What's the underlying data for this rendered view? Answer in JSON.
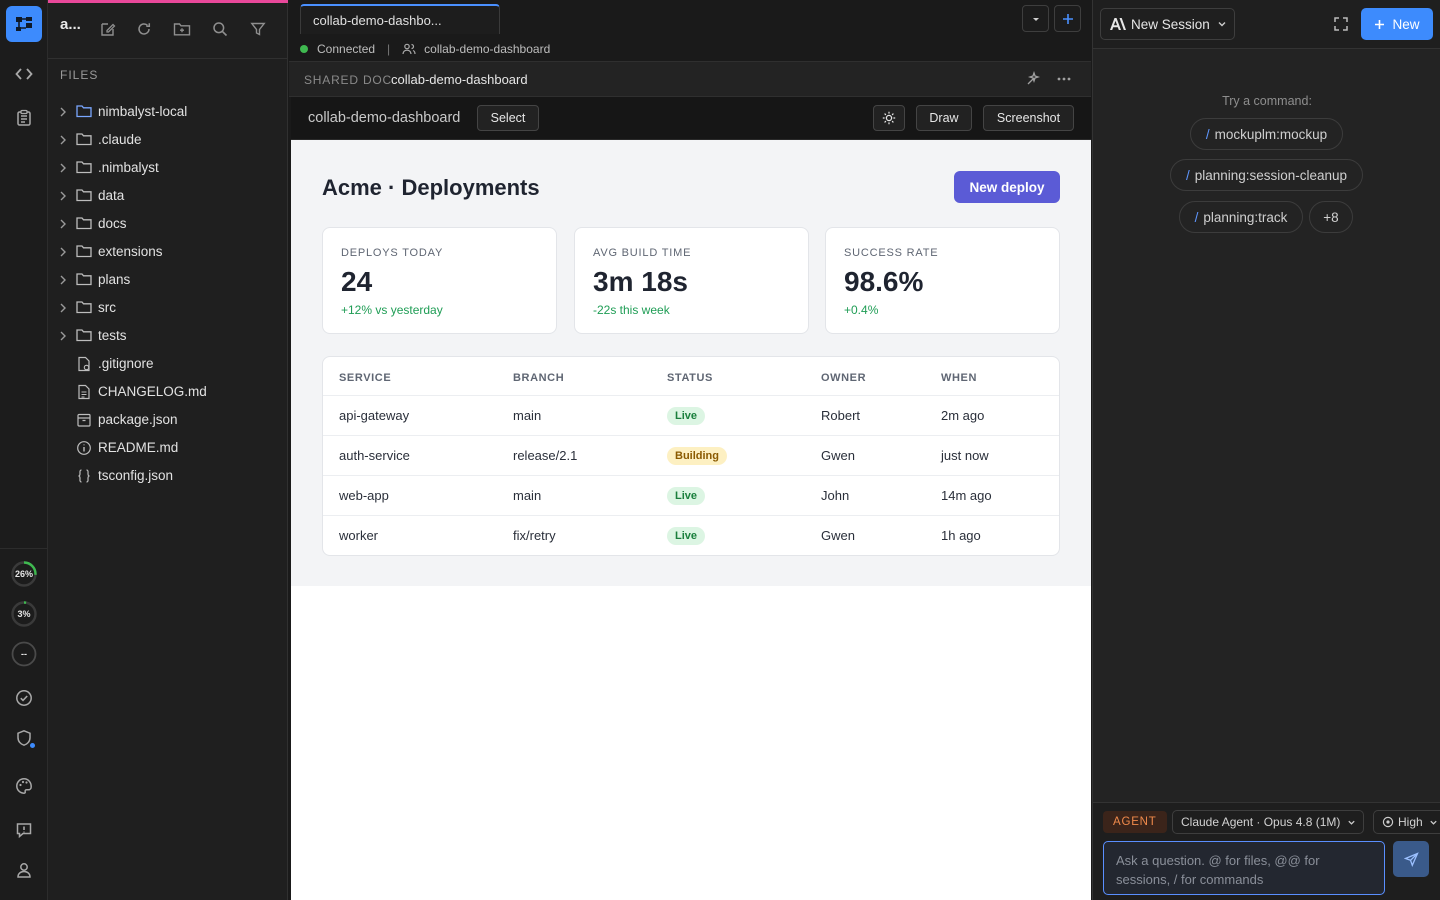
{
  "activity_bar": {
    "usage_rings": [
      {
        "label": "26%",
        "fraction": 0.26
      },
      {
        "label": "3%",
        "fraction": 0.03
      },
      {
        "label": "--",
        "fraction": 0
      }
    ]
  },
  "explorer": {
    "title": "a...",
    "section_label": "FILES",
    "items": [
      {
        "name": "nimbalyst-local",
        "type": "folder",
        "icon": "folder-icon"
      },
      {
        "name": ".claude",
        "type": "folder",
        "icon": "folder-icon"
      },
      {
        "name": ".nimbalyst",
        "type": "folder",
        "icon": "folder-icon"
      },
      {
        "name": "data",
        "type": "folder",
        "icon": "folder-icon"
      },
      {
        "name": "docs",
        "type": "folder",
        "icon": "folder-icon"
      },
      {
        "name": "extensions",
        "type": "folder",
        "icon": "folder-icon"
      },
      {
        "name": "plans",
        "type": "folder",
        "icon": "folder-icon"
      },
      {
        "name": "src",
        "type": "folder",
        "icon": "folder-icon"
      },
      {
        "name": "tests",
        "type": "folder",
        "icon": "folder-icon"
      },
      {
        "name": ".gitignore",
        "type": "file",
        "icon": "gear-file-icon"
      },
      {
        "name": "CHANGELOG.md",
        "type": "file",
        "icon": "document-icon"
      },
      {
        "name": "package.json",
        "type": "file",
        "icon": "package-icon"
      },
      {
        "name": "README.md",
        "type": "file",
        "icon": "info-icon"
      },
      {
        "name": "tsconfig.json",
        "type": "file",
        "icon": "braces-icon"
      }
    ]
  },
  "editor": {
    "tab_label": "collab-demo-dashbo...",
    "connection_status": "Connected",
    "connection_separator": "|",
    "shared_name": "collab-demo-dashboard",
    "doc_kind": "SHARED DOC",
    "doc_name": "collab-demo-dashboard",
    "mockup_title": "collab-demo-dashboard",
    "select_label": "Select",
    "draw_label": "Draw",
    "screenshot_label": "Screenshot"
  },
  "mockup": {
    "title": "Acme · Deployments",
    "new_deploy_label": "New deploy",
    "stats": [
      {
        "label": "DEPLOYS TODAY",
        "value": "24",
        "delta": "+12% vs yesterday"
      },
      {
        "label": "AVG BUILD TIME",
        "value": "3m 18s",
        "delta": "-22s this week"
      },
      {
        "label": "SUCCESS RATE",
        "value": "98.6%",
        "delta": "+0.4%"
      }
    ],
    "table": {
      "headers": [
        "SERVICE",
        "BRANCH",
        "STATUS",
        "OWNER",
        "WHEN"
      ],
      "rows": [
        {
          "service": "api-gateway",
          "branch": "main",
          "status": "Live",
          "owner": "Robert",
          "when": "2m ago"
        },
        {
          "service": "auth-service",
          "branch": "release/2.1",
          "status": "Building",
          "owner": "Gwen",
          "when": "just now"
        },
        {
          "service": "web-app",
          "branch": "main",
          "status": "Live",
          "owner": "John",
          "when": "14m ago"
        },
        {
          "service": "worker",
          "branch": "fix/retry",
          "status": "Live",
          "owner": "Gwen",
          "when": "1h ago"
        }
      ]
    },
    "status_colors": {
      "Live": {
        "bg": "#dcf5e3",
        "fg": "#1a7f3c"
      },
      "Building": {
        "bg": "#fdf0c2",
        "fg": "#8a5a00"
      }
    }
  },
  "agent_panel": {
    "session_label": "New Session",
    "new_label": "New",
    "try_label": "Try a command:",
    "commands": [
      "mockuplm:mockup",
      "planning:session-cleanup",
      "planning:track"
    ],
    "more_label": "+8",
    "agent_badge": "AGENT",
    "model_label": "Claude Agent · Opus 4.8 (1M)",
    "effort_label": "High",
    "input_placeholder": "Ask a question. @ for files, @@ for sessions, / for commands"
  },
  "colors": {
    "accent": "#3d8bfd",
    "brand_button": "#5b5bd6",
    "success": "#1f9d55",
    "connected": "#3fb950",
    "agent_badge": "#f08a4b"
  }
}
